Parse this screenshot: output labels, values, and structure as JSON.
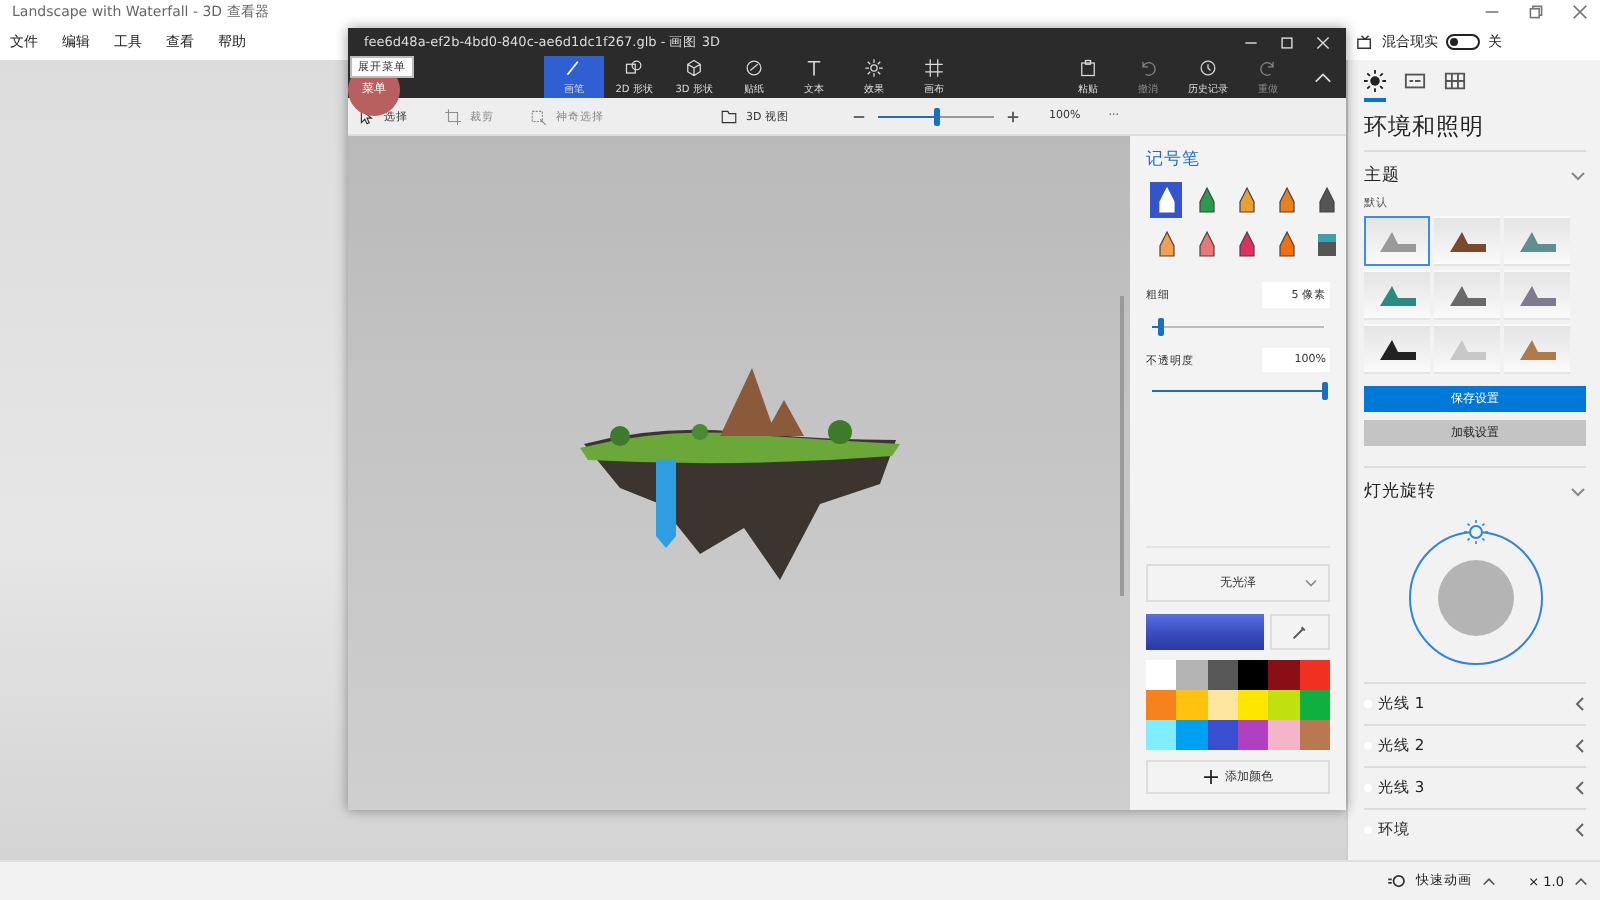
{
  "viewer": {
    "title": "Landscape with Waterfall - 3D 查看器",
    "menu": [
      "文件",
      "编辑",
      "工具",
      "查看",
      "帮助"
    ],
    "mixed_reality": {
      "label": "混合现实",
      "on": false,
      "state_text": "关"
    }
  },
  "panel_tabs": [
    {
      "kind": "lighting",
      "selected": true
    },
    {
      "kind": "stats",
      "selected": false
    },
    {
      "kind": "grid",
      "selected": false
    }
  ],
  "environment": {
    "heading": "环境和照明",
    "theme": {
      "title": "主题",
      "expanded": true,
      "preset_label": "默认",
      "presets": [
        {
          "color": "#9a9a9a",
          "selected": true
        },
        {
          "color": "#7a4a2a",
          "selected": false
        },
        {
          "color": "#5f8f8f",
          "selected": false
        },
        {
          "color": "#2a8c80",
          "selected": false
        },
        {
          "color": "#6a6a6a",
          "selected": false
        },
        {
          "color": "#7f7a90",
          "selected": false
        },
        {
          "color": "#222222",
          "selected": false
        },
        {
          "color": "#c8c8c8",
          "selected": false
        },
        {
          "color": "#b07a4a",
          "selected": false
        }
      ],
      "save_button": "保存设置",
      "load_button": "加载设置"
    },
    "light_rotation": {
      "title": "灯光旋转",
      "expanded": true
    },
    "lights": [
      {
        "label": "光线 1",
        "expanded": false
      },
      {
        "label": "光线 2",
        "expanded": false
      },
      {
        "label": "光线 3",
        "expanded": false
      },
      {
        "label": "环境",
        "expanded": false
      }
    ]
  },
  "status_bar": {
    "quick_animation": "快速动画",
    "speed": "× 1.0"
  },
  "paint3d": {
    "title": "fee6d48a-ef2b-4bd0-840c-ae6d1dc1f267.glb - 画图 3D",
    "menu_button": "菜单",
    "tooltip": "展开菜单",
    "tools": [
      {
        "kind": "brush",
        "label": "画笔",
        "selected": true
      },
      {
        "kind": "shape2d",
        "label": "2D 形状",
        "selected": false
      },
      {
        "kind": "shape3d",
        "label": "3D 形状",
        "selected": false
      },
      {
        "kind": "sticker",
        "label": "贴纸",
        "selected": false
      },
      {
        "kind": "text",
        "label": "文本",
        "selected": false
      },
      {
        "kind": "effects",
        "label": "效果",
        "selected": false
      },
      {
        "kind": "canvas",
        "label": "画布",
        "selected": false
      }
    ],
    "actions": [
      {
        "kind": "paste",
        "label": "粘贴",
        "disabled": false
      },
      {
        "kind": "undo",
        "label": "撤消",
        "disabled": true
      },
      {
        "kind": "history",
        "label": "历史记录",
        "disabled": false
      },
      {
        "kind": "redo",
        "label": "重做",
        "disabled": true
      }
    ],
    "subtools": [
      {
        "kind": "select",
        "label": "选择",
        "disabled": false
      },
      {
        "kind": "crop",
        "label": "裁剪",
        "disabled": true
      },
      {
        "kind": "magic",
        "label": "神奇选择",
        "disabled": true
      }
    ],
    "view_3d": "3D 视图",
    "zoom": {
      "level": 0.5,
      "reading": "100%"
    },
    "more": "···",
    "brush_panel": {
      "title": "记号笔",
      "brushes": [
        {
          "kind": "marker",
          "selected": true
        },
        {
          "kind": "calligraphy",
          "selected": false
        },
        {
          "kind": "oil",
          "selected": false
        },
        {
          "kind": "watercolor",
          "selected": false
        },
        {
          "kind": "pixel",
          "selected": false
        },
        {
          "kind": "pencil",
          "selected": false
        },
        {
          "kind": "eraser",
          "selected": false
        },
        {
          "kind": "crayon",
          "selected": false
        },
        {
          "kind": "spray",
          "selected": false
        },
        {
          "kind": "fill",
          "selected": false
        }
      ],
      "thickness": {
        "label": "粗细",
        "value": "5 像素",
        "level": 0.05
      },
      "opacity": {
        "label": "不透明度",
        "value": "100%",
        "level": 1
      },
      "finish": "无光泽",
      "palette": [
        {
          "color": "#ffffff"
        },
        {
          "color": "#b4b4b4"
        },
        {
          "color": "#575757"
        },
        {
          "color": "#000000"
        },
        {
          "color": "#8a0f15"
        },
        {
          "color": "#f03020"
        },
        {
          "color": "#f5821f"
        },
        {
          "color": "#ffc20e"
        },
        {
          "color": "#fde7a0"
        },
        {
          "color": "#ffe600"
        },
        {
          "color": "#c0e010"
        },
        {
          "color": "#10b040"
        },
        {
          "color": "#80eeff"
        },
        {
          "color": "#00a0f0"
        },
        {
          "color": "#3a4fd0"
        },
        {
          "color": "#b040c0"
        },
        {
          "color": "#f5b5c8"
        },
        {
          "color": "#b87850"
        }
      ],
      "add_color": "添加颜色"
    }
  }
}
